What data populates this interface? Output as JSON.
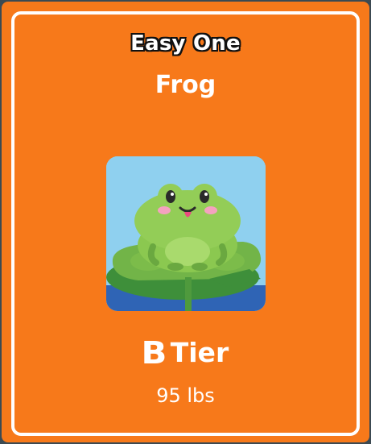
{
  "card": {
    "subtitle": "Easy One",
    "title": "Frog",
    "image_icon": "frog-on-lily-pad-icon",
    "tier": {
      "letter": "B",
      "label": "Tier"
    },
    "weight": "95 lbs"
  },
  "colors": {
    "card_background": "#f7791a",
    "card_border": "#ffffff",
    "text": "#ffffff",
    "subtitle_outline": "#111111"
  }
}
